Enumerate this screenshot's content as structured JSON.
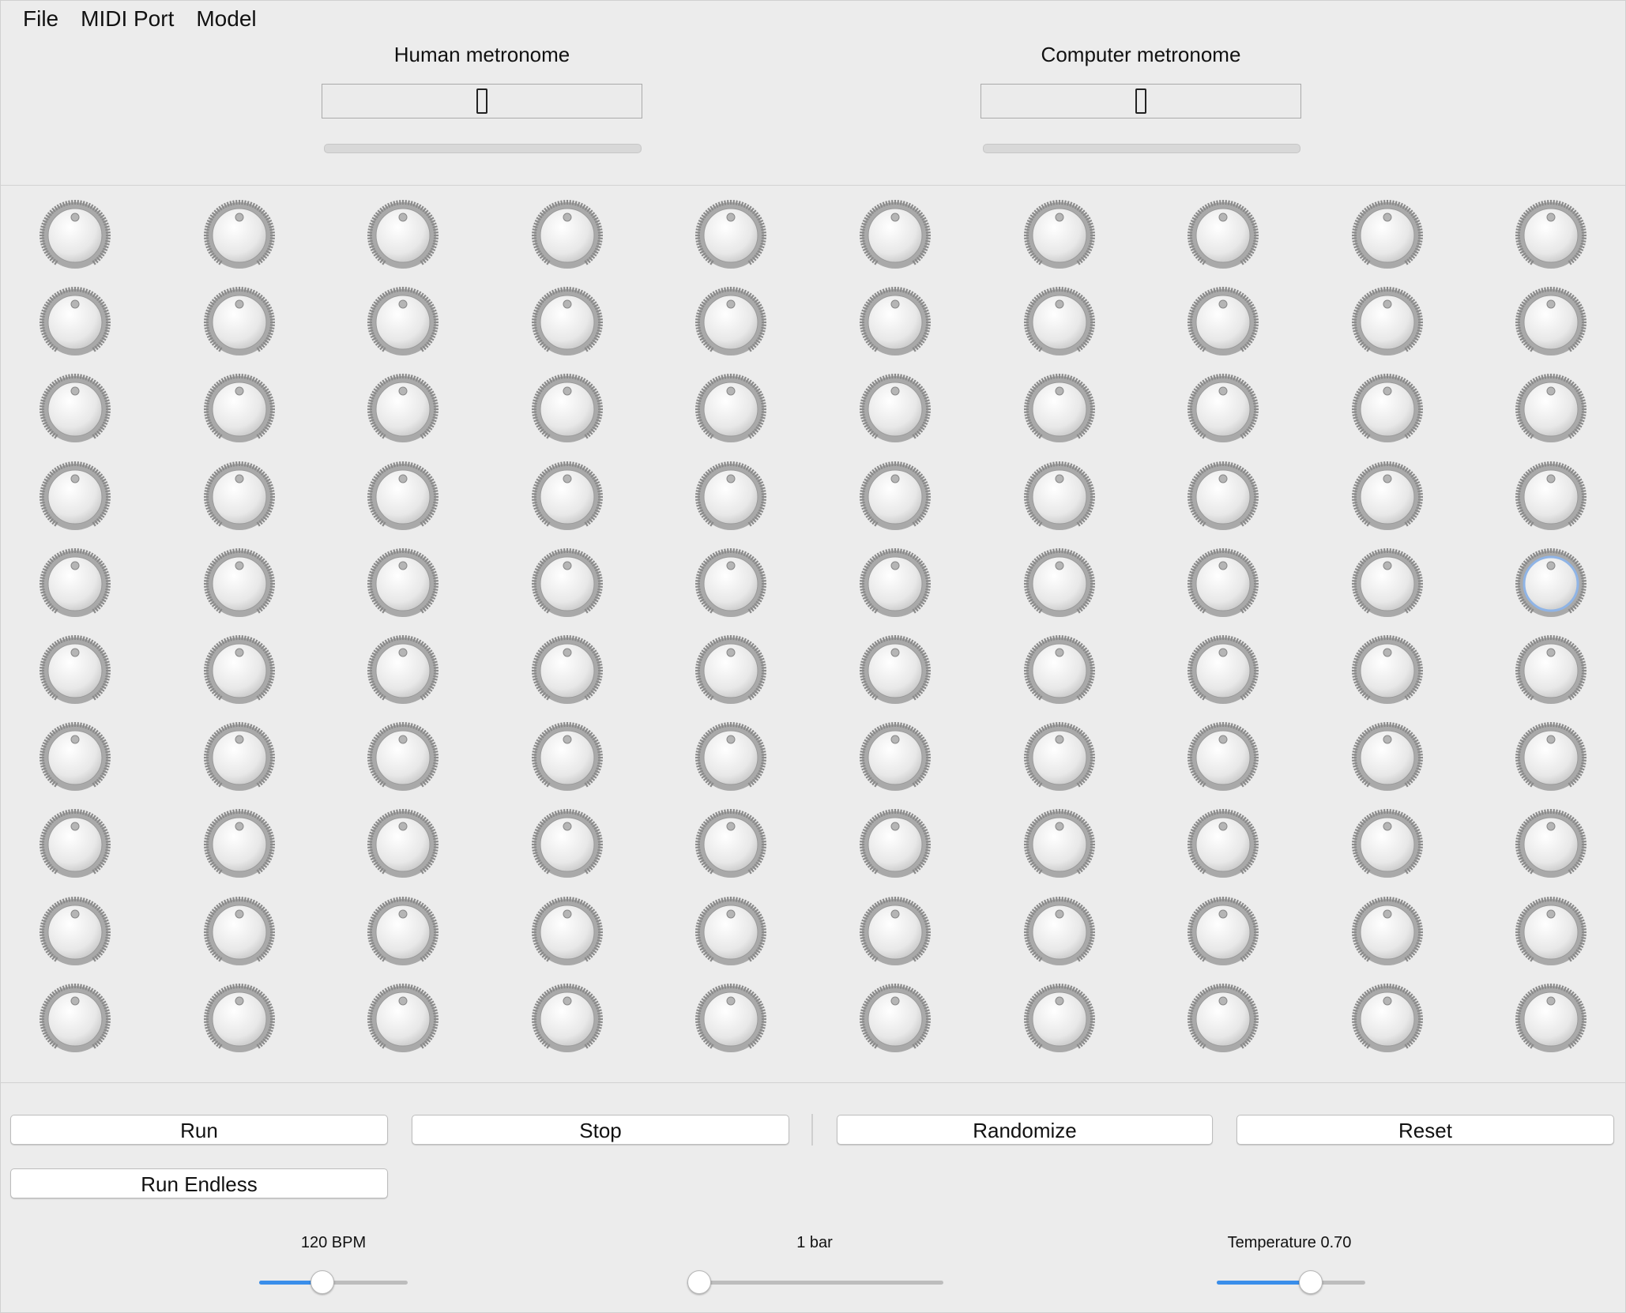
{
  "menu": [
    "File",
    "MIDI Port",
    "Model"
  ],
  "human_metronome": {
    "title": "Human metronome",
    "value": "0"
  },
  "computer_metronome": {
    "title": "Computer metronome",
    "value": "0"
  },
  "knob_grid": {
    "rows": 10,
    "cols": 10,
    "focused": {
      "row": 5,
      "col": 10
    }
  },
  "buttons": {
    "run": "Run",
    "stop": "Stop",
    "randomize": "Randomize",
    "reset": "Reset",
    "run_endless": "Run Endless"
  },
  "sliders": {
    "bpm": {
      "label": "120 BPM",
      "fraction": 0.41
    },
    "bars": {
      "label": "1 bar",
      "fraction": 0.0
    },
    "temperature": {
      "label": "Temperature 0.70",
      "fraction": 0.66
    }
  },
  "colors": {
    "accent": "#3a8eea",
    "background": "#ececec",
    "focus": "#8fb4e6"
  }
}
